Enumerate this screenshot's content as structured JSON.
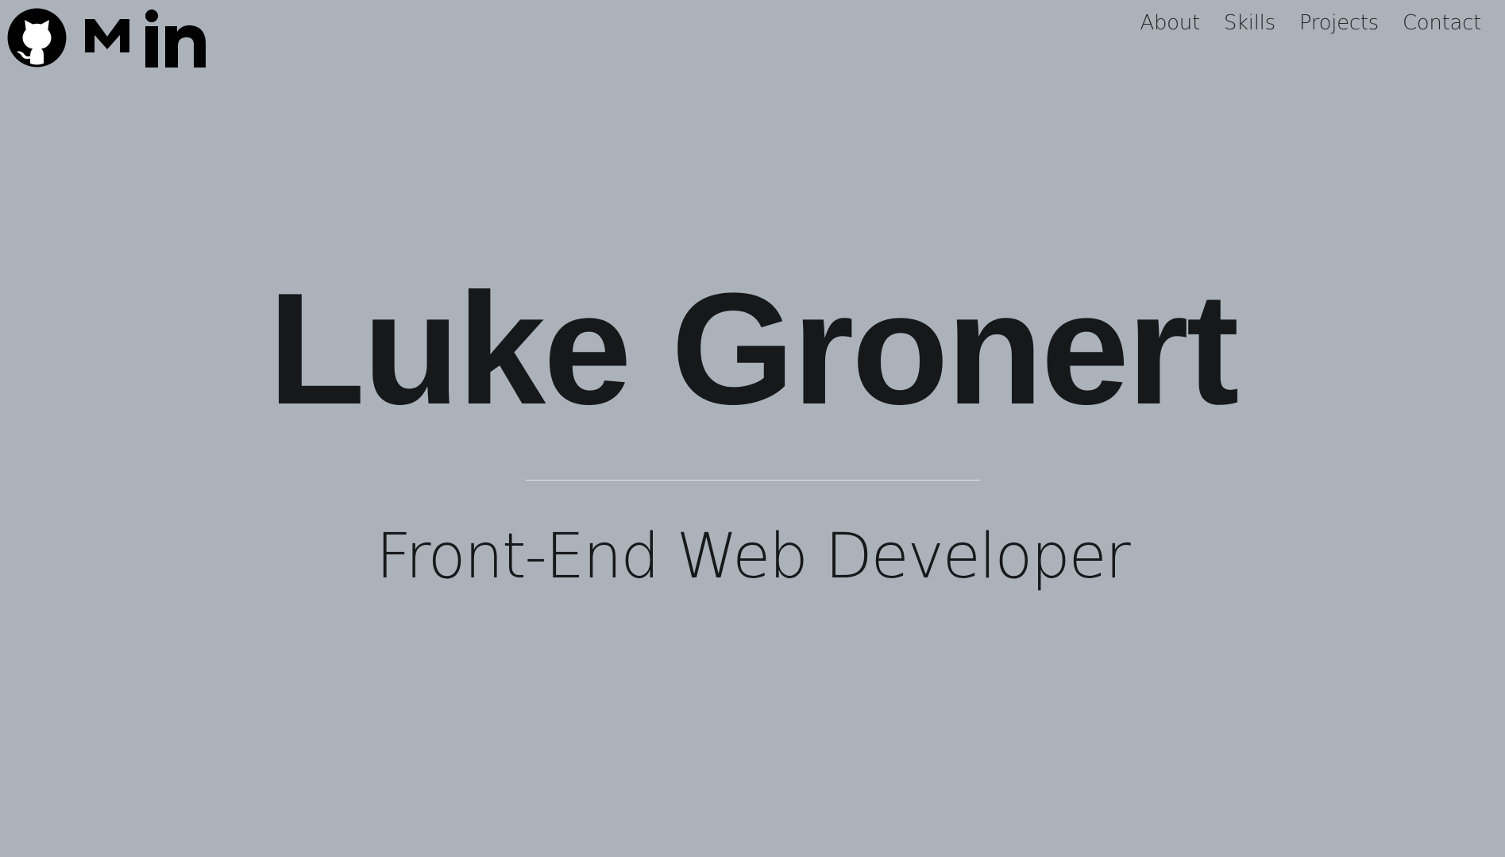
{
  "social": {
    "github_icon": "github-icon",
    "medium_icon": "medium-icon",
    "linkedin_icon": "linkedin-icon"
  },
  "nav": {
    "items": [
      {
        "label": "About"
      },
      {
        "label": "Skills"
      },
      {
        "label": "Projects"
      },
      {
        "label": "Contact"
      }
    ]
  },
  "hero": {
    "name": "Luke Gronert",
    "title": "Front-End Web Developer"
  },
  "colors": {
    "background": "#abb2ba",
    "text": "#16181a",
    "divider": "#e4e7ea"
  }
}
